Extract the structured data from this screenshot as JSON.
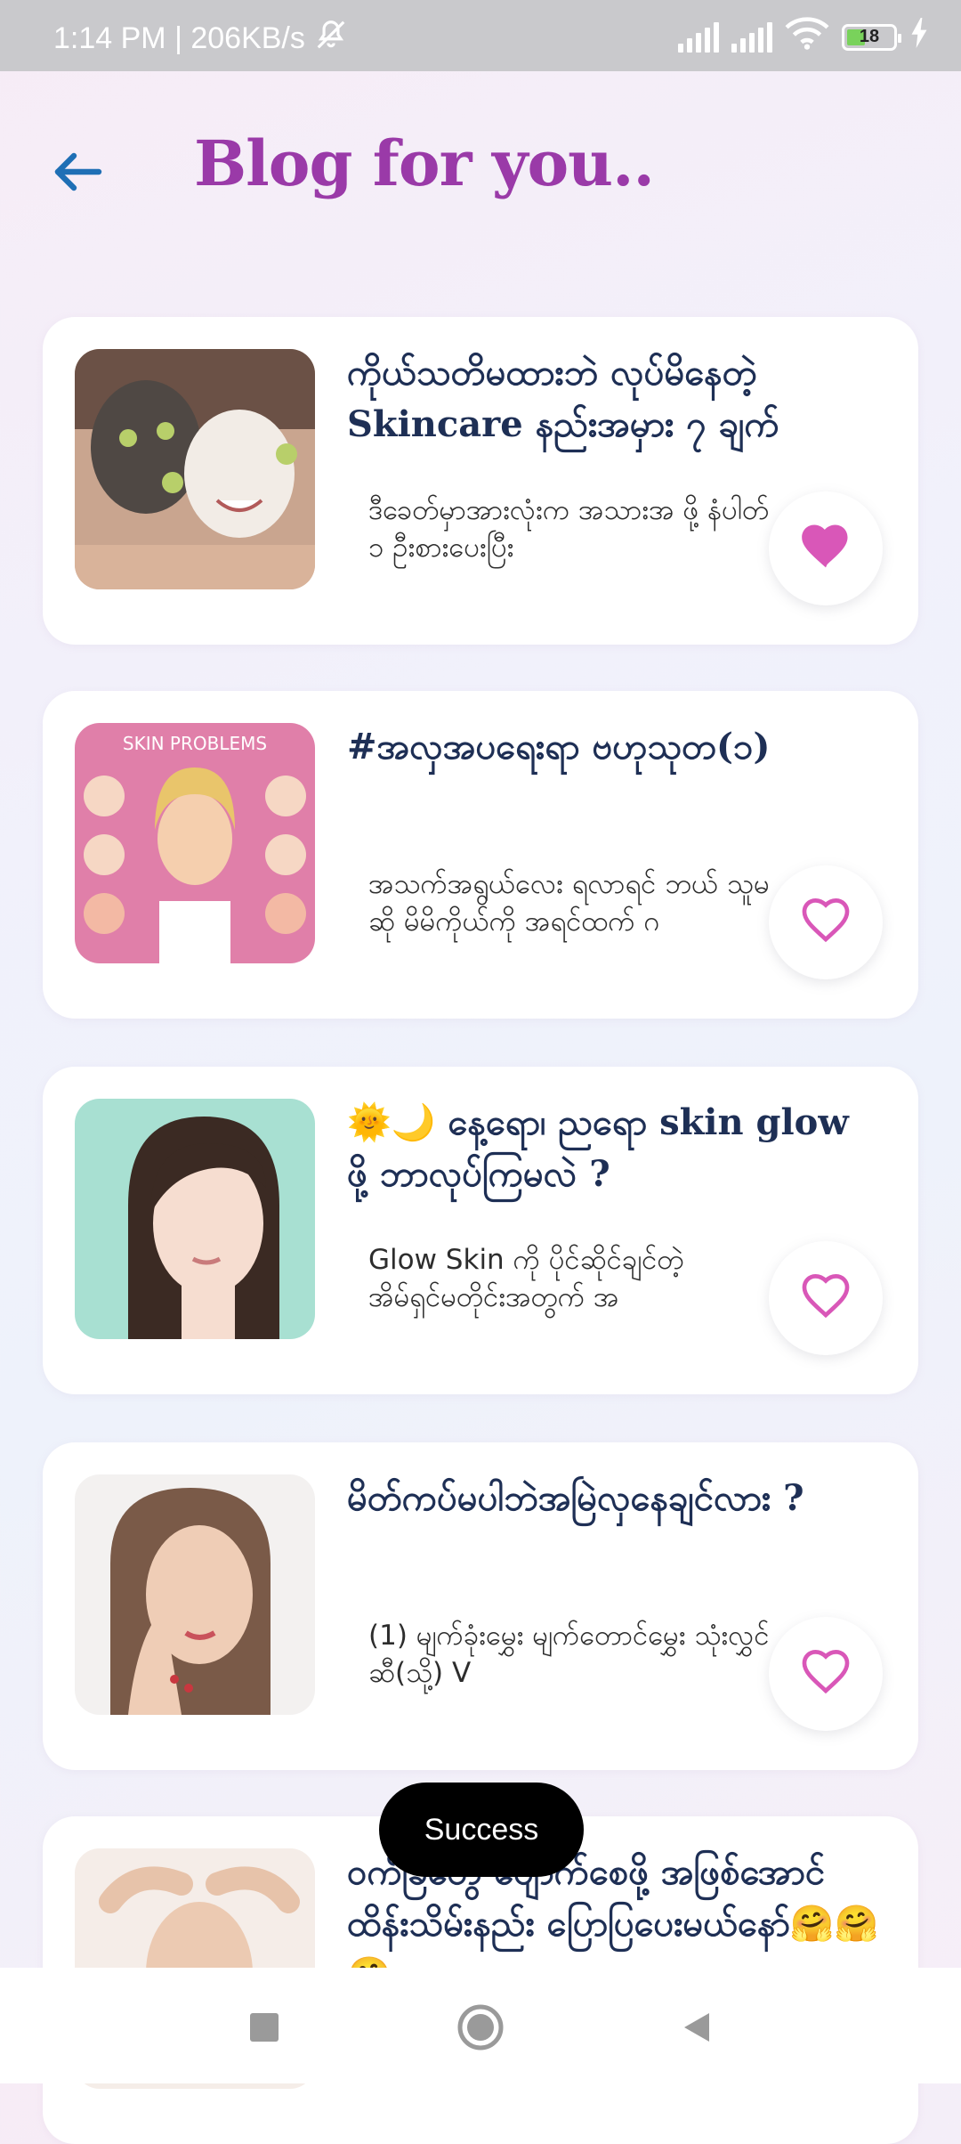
{
  "status_bar": {
    "time_speed": "1:14 PM | 206KB/s",
    "battery_level": "18",
    "icons": [
      "bell-muted-icon",
      "signal-icon",
      "signal-icon",
      "wifi-icon",
      "battery-icon",
      "charging-icon"
    ]
  },
  "header": {
    "back_icon": "arrow-left-icon",
    "title": "Blog for you.."
  },
  "accent": {
    "title": "#9a3aa8",
    "heart": "#d957b8",
    "back_arrow": "#1f6fb5"
  },
  "posts": [
    {
      "title": "ကိုယ်သတိမထားဘဲ လုပ်မိနေတဲ့ Skincare နည်းအမှား ၇ ချက်",
      "excerpt": "ဒီခေတ်မှာအားလုံးက အသားအ ဖို့ နံပါတ် ၁ ဦးစားပေးပြီး",
      "favorited": true,
      "thumb": "face-mask-photo"
    },
    {
      "title": "#အလှအပရေးရာ ဗဟုသုတ(၁)",
      "excerpt": "အသက်အရွယ်လေး ရလာရင် ဘယ် သူမဆို မိမိကိုယ်ကို အရင်ထက် ဂ",
      "favorited": false,
      "thumb": "skin-problems-illustration",
      "thumb_label": "SKIN PROBLEMS"
    },
    {
      "title": "🌞🌙 နေ့ရော၊ ညရော skin glow ဖို့ ဘာလုပ်ကြမလဲ ?",
      "excerpt": "Glow Skin ကို ပိုင်ဆိုင်ချင်တဲ့ အိမ်ရှင်မတိုင်းအတွက် အ",
      "favorited": false,
      "thumb": "glowing-skin-portrait"
    },
    {
      "title": "မိတ်ကပ်မပါဘဲအမြဲလှနေချင်လား ?",
      "excerpt": "(1) မျက်ခုံးမွှေး မျက်တောင်မွှေး သုံးလွှင်ဆီ(သို့) V",
      "favorited": false,
      "thumb": "woman-hands-face-portrait"
    },
    {
      "title": "ဝက်ခြံတွေ ပျောက်စေဖို့ အဖြစ်အောင်ထိန်းသိမ်းနည်း ပြောပြပေးမယ်နော်🤗🤗🤗",
      "excerpt": "",
      "favorited": false,
      "thumb": "acne-woman-portrait"
    }
  ],
  "toast": {
    "message": "Success"
  },
  "nav_bar": {
    "items": [
      "recents-square-icon",
      "home-circle-icon",
      "back-triangle-icon"
    ]
  }
}
